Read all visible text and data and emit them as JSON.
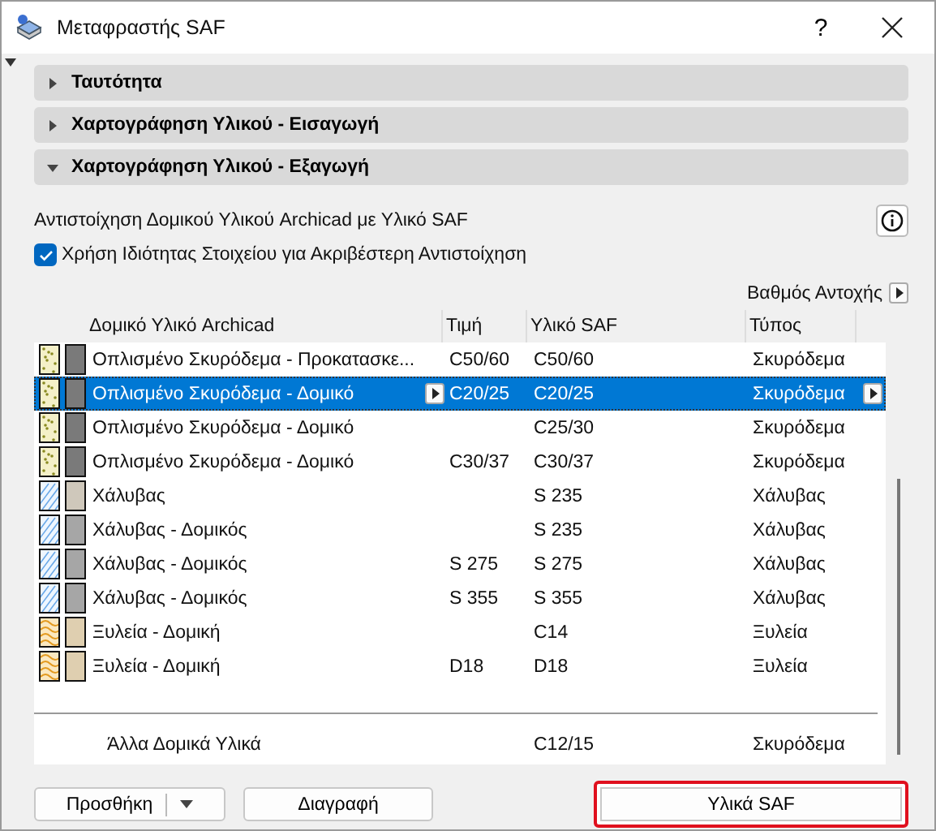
{
  "window": {
    "title": "Μεταφραστής SAF",
    "help": "?"
  },
  "sections": [
    {
      "title": "Ταυτότητα",
      "expanded": false
    },
    {
      "title": "Χαρτογράφηση Υλικού - Εισαγωγή",
      "expanded": false
    },
    {
      "title": "Χαρτογράφηση Υλικού - Εξαγωγή",
      "expanded": true
    }
  ],
  "description": "Αντιστοίχηση Δομικού Υλικού Archicad με Υλικό SAF",
  "option": {
    "label": "Χρήση Ιδιότητας Στοιχείου για Ακριβέστερη Αντιστοίχηση",
    "checked": true
  },
  "fire_rating": "Βαθμός Αντοχής",
  "table": {
    "columns": [
      "Δομικό Υλικό Archicad",
      "Τιμή",
      "Υλικό SAF",
      "Τύπος"
    ],
    "rows": [
      {
        "kind": "concrete",
        "color": "#7a7a7a",
        "name": "Οπλισμένο Σκυρόδεμα - Προκατασκε...",
        "value": "C50/60",
        "saf": "C50/60",
        "type": "Σκυρόδεμα",
        "selected": false
      },
      {
        "kind": "concrete",
        "color": "#7a7a7a",
        "name": "Οπλισμένο Σκυρόδεμα - Δομικό",
        "value": "C20/25",
        "saf": "C20/25",
        "type": "Σκυρόδεμα",
        "selected": true
      },
      {
        "kind": "concrete",
        "color": "#7a7a7a",
        "name": "Οπλισμένο Σκυρόδεμα - Δομικό",
        "value": "",
        "saf": "C25/30",
        "type": "Σκυρόδεμα",
        "selected": false
      },
      {
        "kind": "concrete",
        "color": "#7a7a7a",
        "name": "Οπλισμένο Σκυρόδεμα - Δομικό",
        "value": "C30/37",
        "saf": "C30/37",
        "type": "Σκυρόδεμα",
        "selected": false
      },
      {
        "kind": "steel",
        "color": "#cfc8bb",
        "name": "Χάλυβας",
        "value": "",
        "saf": "S 235",
        "type": "Χάλυβας",
        "selected": false
      },
      {
        "kind": "steel",
        "color": "#a6a6a6",
        "name": "Χάλυβας - Δομικός",
        "value": "",
        "saf": "S 235",
        "type": "Χάλυβας",
        "selected": false
      },
      {
        "kind": "steel",
        "color": "#a6a6a6",
        "name": "Χάλυβας - Δομικός",
        "value": "S 275",
        "saf": "S 275",
        "type": "Χάλυβας",
        "selected": false
      },
      {
        "kind": "steel",
        "color": "#a6a6a6",
        "name": "Χάλυβας - Δομικός",
        "value": "S 355",
        "saf": "S 355",
        "type": "Χάλυβας",
        "selected": false
      },
      {
        "kind": "timber",
        "color": "#dfcfb0",
        "name": "Ξυλεία - Δομική",
        "value": "",
        "saf": "C14",
        "type": "Ξυλεία",
        "selected": false
      },
      {
        "kind": "timber",
        "color": "#dfcfb0",
        "name": "Ξυλεία - Δομική",
        "value": "D18",
        "saf": "D18",
        "type": "Ξυλεία",
        "selected": false
      }
    ],
    "other": {
      "name": "Άλλα Δομικά Υλικά",
      "saf": "C12/15",
      "type": "Σκυρόδεμα"
    }
  },
  "buttons": [
    {
      "label": "Προσθήκη",
      "kind": "split",
      "highlighted": false
    },
    {
      "label": "Διαγραφή",
      "kind": "plain",
      "highlighted": false
    },
    {
      "label": "Υλικά SAF",
      "kind": "wide",
      "highlighted": true
    }
  ]
}
